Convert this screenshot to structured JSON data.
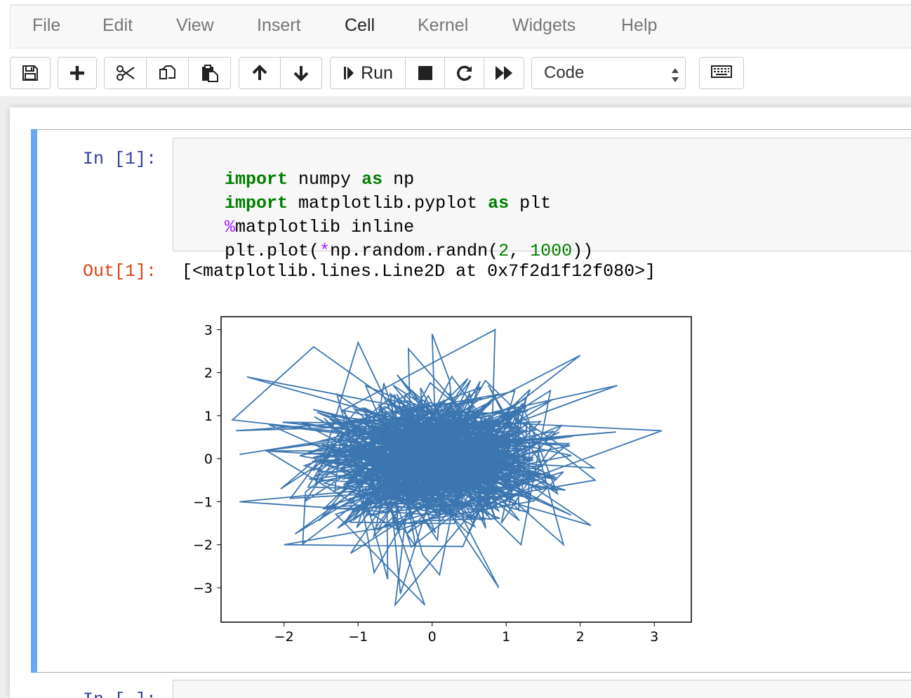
{
  "menubar": {
    "items": [
      "File",
      "Edit",
      "View",
      "Insert",
      "Cell",
      "Kernel",
      "Widgets",
      "Help"
    ],
    "active": "Cell"
  },
  "toolbar": {
    "run_label": "Run",
    "cell_type": "Code",
    "icons": [
      "save-icon",
      "plus-icon",
      "cut-icon",
      "copy-icon",
      "paste-icon",
      "arrow-up-icon",
      "arrow-down-icon",
      "step-run-icon",
      "stop-icon",
      "restart-icon",
      "fast-forward-icon",
      "keyboard-icon"
    ]
  },
  "cell1": {
    "in_prompt": "In [1]:",
    "code": [
      {
        "parts": [
          {
            "t": "import",
            "c": "kw"
          },
          {
            "t": " numpy ",
            "c": ""
          },
          {
            "t": "as",
            "c": "kw"
          },
          {
            "t": " np",
            "c": ""
          }
        ]
      },
      {
        "parts": [
          {
            "t": "import",
            "c": "kw"
          },
          {
            "t": " matplotlib.pyplot ",
            "c": ""
          },
          {
            "t": "as",
            "c": "kw"
          },
          {
            "t": " plt",
            "c": ""
          }
        ]
      },
      {
        "parts": [
          {
            "t": "%",
            "c": "mag"
          },
          {
            "t": "matplotlib inline",
            "c": ""
          }
        ]
      },
      {
        "parts": [
          {
            "t": "plt.plot(",
            "c": ""
          },
          {
            "t": "*",
            "c": "mag"
          },
          {
            "t": "np.random.randn(",
            "c": ""
          },
          {
            "t": "2",
            "c": "num"
          },
          {
            "t": ", ",
            "c": ""
          },
          {
            "t": "1000",
            "c": "num"
          },
          {
            "t": "))",
            "c": ""
          }
        ]
      }
    ],
    "out_prompt": "Out[1]:",
    "out_text": "[<matplotlib.lines.Line2D at 0x7f2d1f12f080>]"
  },
  "chart_data": {
    "type": "line",
    "title": "",
    "xlabel": "",
    "ylabel": "",
    "xlim": [
      -2.85,
      3.5
    ],
    "ylim": [
      -3.8,
      3.3
    ],
    "xticks": [
      "−2",
      "−1",
      "0",
      "1",
      "2",
      "3"
    ],
    "yticks": [
      "3",
      "2",
      "1",
      "0",
      "−1",
      "−2",
      "−3"
    ],
    "xtick_values": [
      -2,
      -1,
      0,
      1,
      2,
      3
    ],
    "ytick_values": [
      3,
      2,
      1,
      0,
      -1,
      -2,
      -3
    ],
    "line_color": "#3c76b0",
    "series": [
      {
        "points_count": 1000,
        "description_points": [
          [
            -2.6,
            0.1
          ],
          [
            -2.65,
            0.65
          ],
          [
            -2.5,
            1.9
          ],
          [
            -2.6,
            -1.0
          ],
          [
            -1.6,
            2.6
          ],
          [
            -1.0,
            2.7
          ],
          [
            0.85,
            3.0
          ],
          [
            0.0,
            2.9
          ],
          [
            2.0,
            2.4
          ],
          [
            2.5,
            1.7
          ],
          [
            3.1,
            0.65
          ],
          [
            2.2,
            -0.5
          ],
          [
            1.45,
            -0.95
          ],
          [
            1.2,
            -2.0
          ],
          [
            0.9,
            -3.0
          ],
          [
            0.1,
            -2.7
          ],
          [
            -0.1,
            -3.4
          ],
          [
            -0.5,
            -3.4
          ],
          [
            -0.6,
            -2.8
          ],
          [
            -1.1,
            -2.2
          ],
          [
            -1.85,
            -1.75
          ],
          [
            -2.0,
            -2.0
          ]
        ]
      }
    ]
  },
  "cell2": {
    "in_prompt": "In [ ]:"
  }
}
